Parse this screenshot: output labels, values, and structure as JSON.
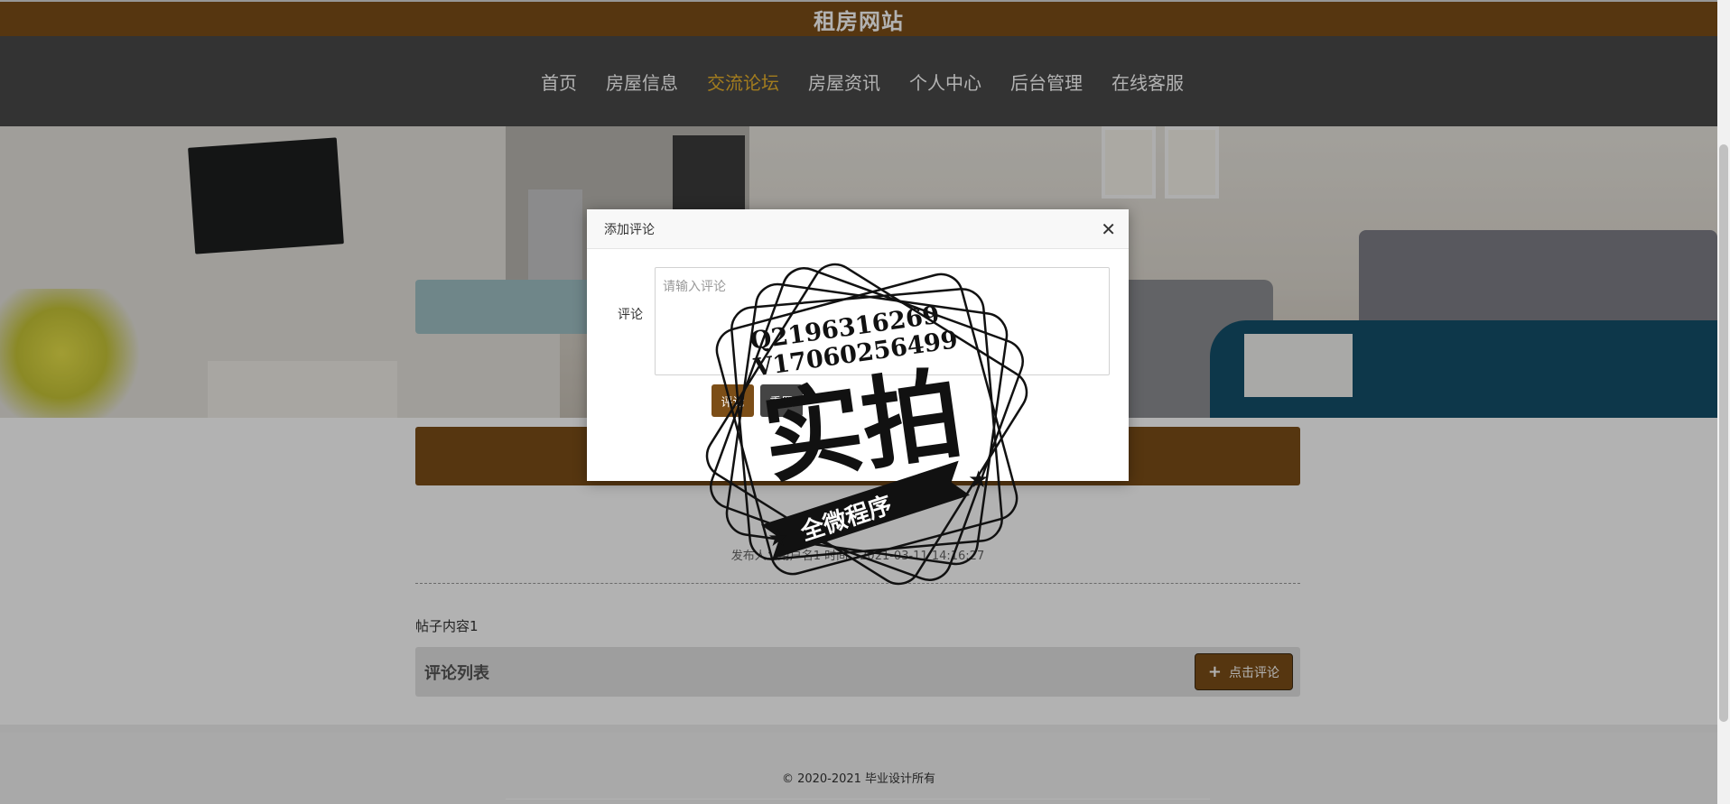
{
  "header": {
    "site_title": "租房网站"
  },
  "nav": {
    "items": [
      {
        "label": "首页"
      },
      {
        "label": "房屋信息"
      },
      {
        "label": "交流论坛"
      },
      {
        "label": "房屋资讯"
      },
      {
        "label": "个人中心"
      },
      {
        "label": "后台管理"
      },
      {
        "label": "在线客服"
      }
    ],
    "active_index": 2
  },
  "post": {
    "meta": "发布人：用户名1 时间：2021-03-11 14:16:27",
    "content": "帖子内容1"
  },
  "comments": {
    "heading": "评论列表",
    "add_button_label": "点击评论"
  },
  "modal": {
    "title": "添加评论",
    "field_label": "评论",
    "placeholder": "请输入评论",
    "submit_label": "评论",
    "reset_label": "重置"
  },
  "watermark": {
    "line1": "Q2196316269",
    "line2": "V17060256499",
    "big_text": "实拍",
    "ribbon_text": "全微程序"
  },
  "footer": {
    "copyright": "© 2020-2021 毕业设计所有"
  },
  "colors": {
    "brand": "#7c4e17",
    "nav_bg": "#4a4a4a",
    "nav_active": "#e9b22c"
  }
}
